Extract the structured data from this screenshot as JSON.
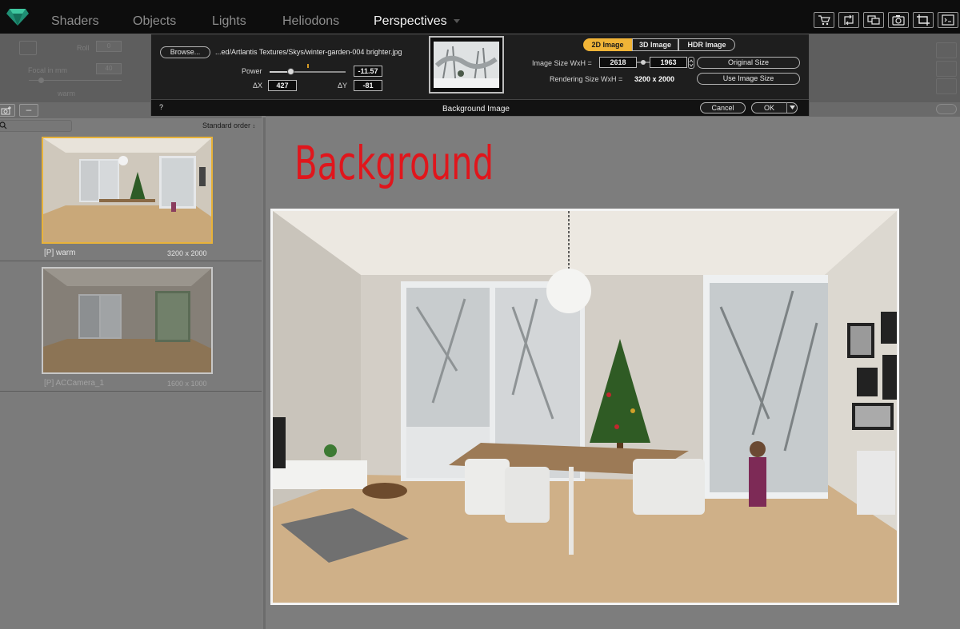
{
  "menu": {
    "tabs": [
      {
        "label": "Shaders"
      },
      {
        "label": "Objects"
      },
      {
        "label": "Lights"
      },
      {
        "label": "Heliodons"
      },
      {
        "label": "Perspectives"
      }
    ],
    "active_tab": "Perspectives",
    "tools": [
      "cart-icon",
      "export-arrows-icon",
      "windows-icon",
      "camera-icon",
      "crop-icon",
      "terminal-icon"
    ]
  },
  "controls_behind": {
    "roll_label": "Roll",
    "roll_value": "0",
    "focal_label": "Focal in mm",
    "focal_value": "40",
    "current_name": "warm"
  },
  "dialog": {
    "title": "Background Image",
    "browse_label": "Browse...",
    "file_path": "...ed/Artlantis Textures/Skys/winter-garden-004 brighter.jpg",
    "power_label": "Power",
    "power_value": "-11.57",
    "power_level": 0.28,
    "dx_label": "ΔX",
    "dx_value": "427",
    "dy_label": "ΔY",
    "dy_value": "-81",
    "modes": [
      {
        "label": "2D Image",
        "selected": true
      },
      {
        "label": "3D Image",
        "selected": false
      },
      {
        "label": "HDR Image",
        "selected": false
      }
    ],
    "image_size_label": "Image Size WxH =",
    "image_width": "2618",
    "image_height": "1963",
    "original_size_label": "Original Size",
    "rendering_size_label": "Rendering Size WxH =",
    "rendering_size_value": "3200 x 2000",
    "use_image_size_label": "Use Image Size",
    "help_label": "?",
    "cancel_label": "Cancel",
    "ok_label": "OK"
  },
  "left_panel": {
    "sort_label": "Standard order",
    "items": [
      {
        "name": "[P] warm",
        "size": "3200 x 2000",
        "selected": true
      },
      {
        "name": "[P] ACCamera_1",
        "size": "1600 x 1000",
        "selected": false
      }
    ]
  },
  "canvas": {
    "heading": "Background"
  },
  "colors": {
    "accent": "#f0b437",
    "heading": "#e0161c",
    "topbar": "#0d0d0d",
    "dialog": "#1e1e1e"
  }
}
